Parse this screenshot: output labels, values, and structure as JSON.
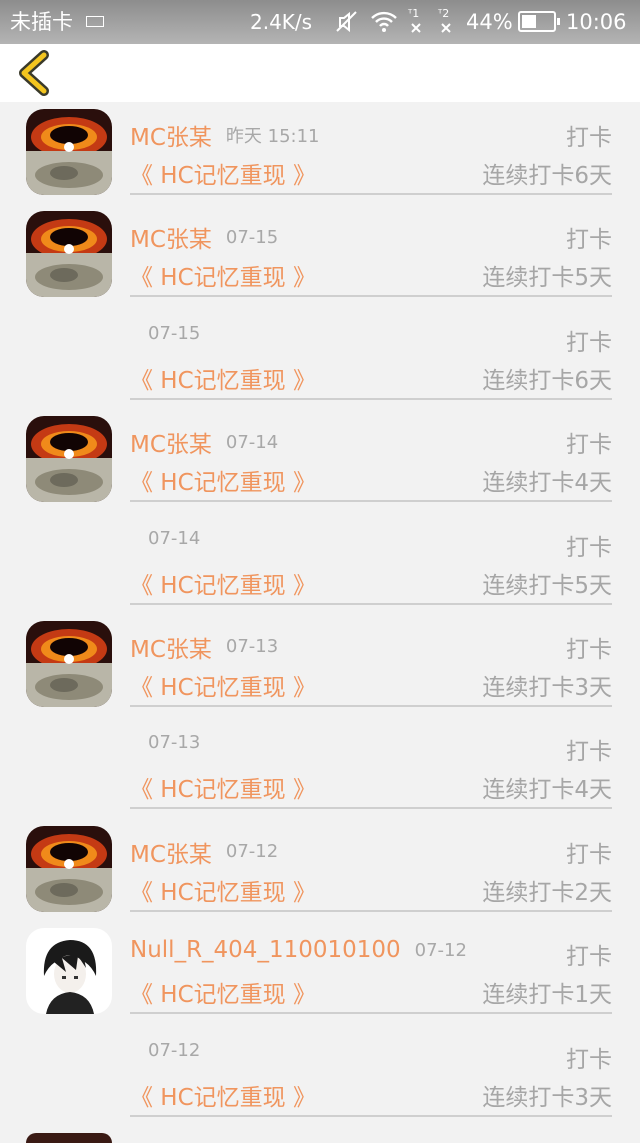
{
  "status_bar": {
    "sim": "未插卡",
    "speed": "2.4K/s",
    "sig1": "᯾1",
    "sig2": "᯾2",
    "battery_pct": "44%",
    "battery_level": 0.44,
    "time": "10:06"
  },
  "header": {
    "back_icon": "chevron-left-icon",
    "accent": "#f0c020"
  },
  "colors": {
    "name": "#f0955e",
    "meta": "#a8a8a8",
    "divider": "#cfcfcf"
  },
  "entries": [
    {
      "avatar": "blackhole",
      "name": "MC张某",
      "date": "昨天 15:11",
      "action": "打卡",
      "book": "《 HC记忆重现 》",
      "streak": "连续打卡6天"
    },
    {
      "avatar": "blackhole",
      "name": "MC张某",
      "date": "07-15",
      "action": "打卡",
      "book": "《 HC记忆重现 》",
      "streak": "连续打卡5天"
    },
    {
      "avatar": null,
      "name": "",
      "date": "07-15",
      "action": "打卡",
      "book": "《 HC记忆重现 》",
      "streak": "连续打卡6天"
    },
    {
      "avatar": "blackhole",
      "name": "MC张某",
      "date": "07-14",
      "action": "打卡",
      "book": "《 HC记忆重现 》",
      "streak": "连续打卡4天"
    },
    {
      "avatar": null,
      "name": "",
      "date": "07-14",
      "action": "打卡",
      "book": "《 HC记忆重现 》",
      "streak": "连续打卡5天"
    },
    {
      "avatar": "blackhole",
      "name": "MC张某",
      "date": "07-13",
      "action": "打卡",
      "book": "《 HC记忆重现 》",
      "streak": "连续打卡3天"
    },
    {
      "avatar": null,
      "name": "",
      "date": "07-13",
      "action": "打卡",
      "book": "《 HC记忆重现 》",
      "streak": "连续打卡4天"
    },
    {
      "avatar": "blackhole",
      "name": "MC张某",
      "date": "07-12",
      "action": "打卡",
      "book": "《 HC记忆重现 》",
      "streak": "连续打卡2天"
    },
    {
      "avatar": "anime",
      "name": "Null_R_404_110010100",
      "date": "07-12",
      "action": "打卡",
      "book": "《 HC记忆重现 》",
      "streak": "连续打卡1天"
    },
    {
      "avatar": null,
      "name": "",
      "date": "07-12",
      "action": "打卡",
      "book": "《 HC记忆重现 》",
      "streak": "连续打卡3天"
    }
  ]
}
